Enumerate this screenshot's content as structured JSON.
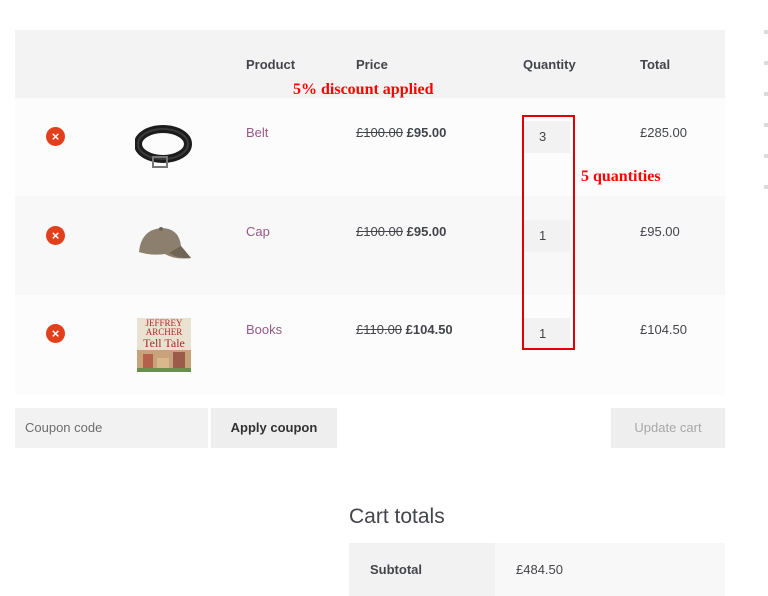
{
  "annotations": {
    "discount": "5% discount applied",
    "quantities": "5 quantities"
  },
  "table": {
    "headers": {
      "product": "Product",
      "price": "Price",
      "quantity": "Quantity",
      "total": "Total"
    },
    "rows": [
      {
        "product": "Belt",
        "old_price": "£100.00",
        "new_price": "£95.00",
        "quantity": "3",
        "total": "£285.00",
        "image_icon": "belt-image"
      },
      {
        "product": "Cap",
        "old_price": "£100.00",
        "new_price": "£95.00",
        "quantity": "1",
        "total": "£95.00",
        "image_icon": "cap-image"
      },
      {
        "product": "Books",
        "old_price": "£110.00",
        "new_price": "£104.50",
        "quantity": "1",
        "total": "£104.50",
        "image_icon": "book-cover-image"
      }
    ],
    "remove_symbol": "×"
  },
  "book_cover": {
    "author": "JEFFREY ARCHER",
    "title": "Tell Tale"
  },
  "actions": {
    "coupon_placeholder": "Coupon code",
    "apply_coupon": "Apply coupon",
    "update_cart": "Update cart"
  },
  "totals": {
    "heading": "Cart totals",
    "subtotal_label": "Subtotal",
    "subtotal_value": "£484.50"
  },
  "colors": {
    "remove": "#e2401c",
    "link": "#96588a",
    "annotation": "#ff0000"
  }
}
